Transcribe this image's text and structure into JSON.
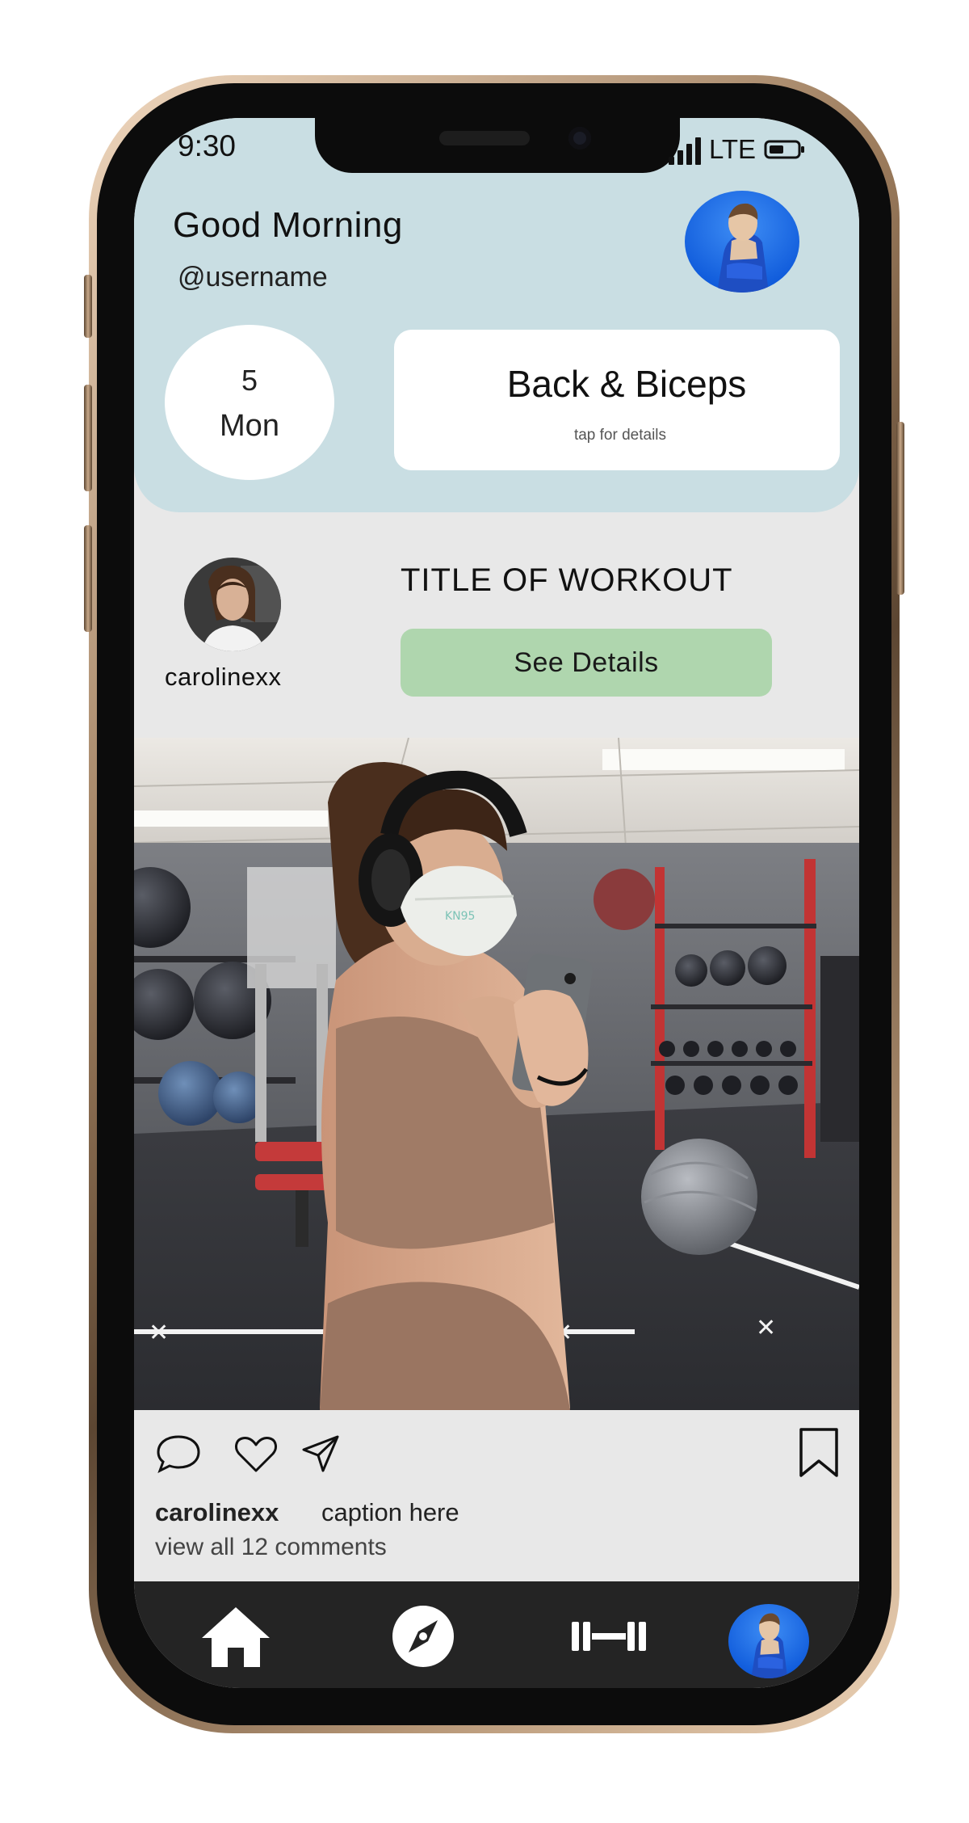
{
  "status_bar": {
    "time": "9:30",
    "network": "LTE"
  },
  "header": {
    "greeting": "Good Morning",
    "username": "@username",
    "date": {
      "day": "5",
      "weekday": "Mon"
    },
    "workout_card": {
      "title": "Back & Biceps",
      "hint": "tap for details"
    }
  },
  "post": {
    "author": "carolinexx",
    "workout_title": "TITLE OF WORKOUT",
    "details_button": "See Details",
    "caption_author": "carolinexx",
    "caption": "caption here",
    "comments_link": "view all 12 comments"
  },
  "nav": {
    "items": [
      "home-icon",
      "compass-icon",
      "dumbbell-icon",
      "profile-avatar"
    ]
  },
  "colors": {
    "header_bg": "#c9dee3",
    "content_bg": "#e8e8e8",
    "button_green": "#afd6ae",
    "nav_bg": "#242424"
  }
}
